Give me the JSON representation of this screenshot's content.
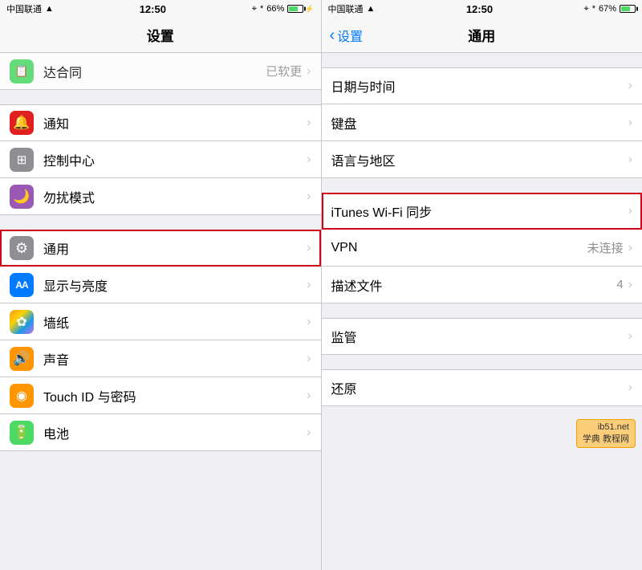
{
  "leftPanel": {
    "statusBar": {
      "carrier": "中国联通",
      "wifi": true,
      "time": "12:50",
      "locationIcon": true,
      "bluetooth": true,
      "battery": "66%",
      "charging": true
    },
    "navTitle": "设置",
    "partialRow": {
      "label": "达合同",
      "value": "已软更"
    },
    "sections": [
      {
        "rows": [
          {
            "id": "notification",
            "icon": "bell",
            "iconColor": "icon-red",
            "label": "通知",
            "iconChar": "🔔"
          },
          {
            "id": "control-center",
            "icon": "sliders",
            "iconColor": "icon-gray",
            "label": "控制中心",
            "iconChar": "⊞"
          },
          {
            "id": "dnd",
            "icon": "moon",
            "iconColor": "icon-purple",
            "label": "勿扰模式",
            "iconChar": "🌙"
          }
        ]
      },
      {
        "rows": [
          {
            "id": "general",
            "icon": "gear",
            "iconColor": "icon-gray",
            "label": "通用",
            "iconChar": "⚙",
            "highlighted": true
          },
          {
            "id": "display",
            "icon": "aa",
            "iconColor": "icon-aa",
            "label": "显示与亮度",
            "iconChar": "AA"
          },
          {
            "id": "wallpaper",
            "icon": "flower",
            "iconColor": "icon-teal",
            "label": "墙纸",
            "iconChar": "✿"
          },
          {
            "id": "sounds",
            "icon": "speaker",
            "iconColor": "icon-orange",
            "label": "声音",
            "iconChar": "🔊"
          },
          {
            "id": "touchid",
            "icon": "finger",
            "iconColor": "icon-fingerprint",
            "label": "Touch ID 与密码",
            "iconChar": "◉"
          },
          {
            "id": "battery",
            "icon": "battery",
            "iconColor": "icon-green",
            "label": "电池",
            "iconChar": "🔋"
          }
        ]
      }
    ]
  },
  "rightPanel": {
    "statusBar": {
      "carrier": "中国联通",
      "wifi": true,
      "time": "12:50",
      "locationIcon": true,
      "bluetooth": true,
      "battery": "67%",
      "charging": false
    },
    "navBack": "设置",
    "navTitle": "通用",
    "sections": [
      {
        "rows": [
          {
            "id": "datetime",
            "label": "日期与时间"
          },
          {
            "id": "keyboard",
            "label": "键盘"
          },
          {
            "id": "language",
            "label": "语言与地区"
          }
        ]
      },
      {
        "rows": [
          {
            "id": "itunes-wifi",
            "label": "iTunes Wi-Fi 同步",
            "highlighted": true
          },
          {
            "id": "vpn",
            "label": "VPN",
            "value": "未连接"
          },
          {
            "id": "profile",
            "label": "描述文件",
            "value": "4"
          }
        ]
      },
      {
        "rows": [
          {
            "id": "supervision",
            "label": "监管"
          }
        ]
      },
      {
        "rows": [
          {
            "id": "reset",
            "label": "还原"
          }
        ]
      }
    ]
  },
  "watermark": {
    "text": "ib51.net",
    "subtext": "学典 教程网"
  }
}
